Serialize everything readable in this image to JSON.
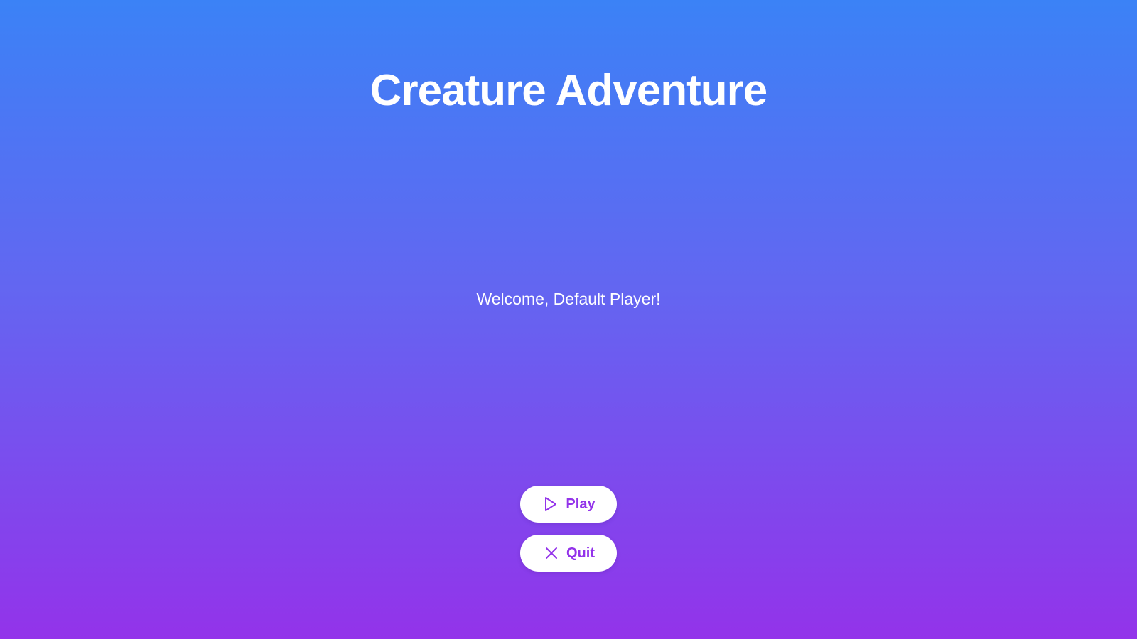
{
  "title": "Creature Adventure",
  "welcome_text": "Welcome, Default Player!",
  "menu": {
    "play": {
      "label": "Play",
      "icon": "play-icon"
    },
    "quit": {
      "label": "Quit",
      "icon": "close-icon"
    }
  },
  "colors": {
    "gradient_top": "#3b82f6",
    "gradient_mid": "#6366f1",
    "gradient_bottom": "#9333ea",
    "button_text": "#9333ea",
    "button_background": "#ffffff",
    "text": "#ffffff"
  }
}
